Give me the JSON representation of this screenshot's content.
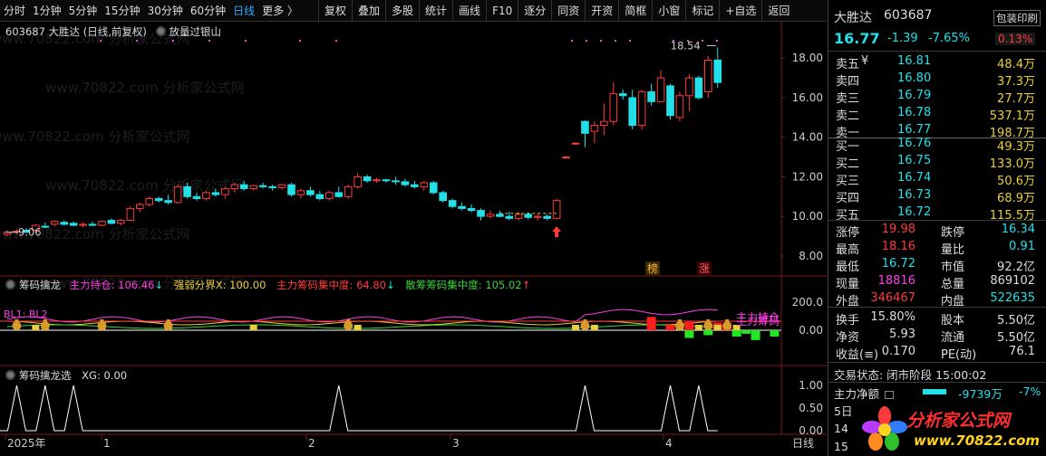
{
  "toolbar": {
    "timeframes": [
      "分时",
      "1分钟",
      "5分钟",
      "15分钟",
      "30分钟",
      "60分钟",
      "日线",
      "更多 〉"
    ],
    "active_timeframe": "日线",
    "buttons": [
      "复权",
      "叠加",
      "多股",
      "统计",
      "画线",
      "F10",
      "逐分",
      "同资",
      "开资",
      "简框",
      "小窗",
      "标记",
      "+自选",
      "返回"
    ]
  },
  "chart_header": {
    "code_name": "603687 大胜达 (日线,前复权)",
    "pattern_label": "放量过银山"
  },
  "price_axis": [
    "18.00",
    "16.00",
    "14.00",
    "12.00",
    "10.00",
    "8.00"
  ],
  "annotations": {
    "high": "18.54",
    "low": "9.06",
    "badge_bang": "榜",
    "badge_zhang": "涨"
  },
  "watermark": "www.70822.com 分析家公式网",
  "indicator1": {
    "name": "筹码擒龙",
    "item1_label": "主力持仓: 106.46",
    "item1_arrow": "↓",
    "item2_label": "强弱分界X: 100.00",
    "item3_label": "主力筹码集中度: 64.80",
    "item3_arrow": "↓",
    "item4_label": "散筹筹码集中度: 105.02",
    "item4_arrow": "↑",
    "axis": [
      "200.0",
      "0.00"
    ],
    "left_tags": "BL1: BL2",
    "right_tag": "主力持仓",
    "right_tag2": "主力筹码"
  },
  "indicator2": {
    "name": "筹码擒龙选",
    "xg_label": "XG: 0.00",
    "axis": [
      "1.00",
      "0.50",
      "0.00"
    ]
  },
  "date_axis": {
    "labels": [
      "2025年",
      "1",
      "2",
      "3",
      "4"
    ],
    "period": "日线"
  },
  "panel": {
    "name": "大胜达",
    "code": "603687",
    "tag": "包装印刷",
    "price": "16.77",
    "change": "-1.39",
    "change_pct": "-7.65%",
    "weibi": "0.13%",
    "asks": [
      {
        "label": "卖五",
        "mark": "¥",
        "price": "16.81",
        "vol": "48.4万"
      },
      {
        "label": "卖四",
        "mark": "",
        "price": "16.80",
        "vol": "37.3万"
      },
      {
        "label": "卖三",
        "mark": "",
        "price": "16.79",
        "vol": "27.7万"
      },
      {
        "label": "卖二",
        "mark": "",
        "price": "16.78",
        "vol": "537.1万"
      },
      {
        "label": "卖一",
        "mark": "",
        "price": "16.77",
        "vol": "198.7万"
      }
    ],
    "bids": [
      {
        "label": "买一",
        "price": "16.76",
        "vol": "49.3万"
      },
      {
        "label": "买二",
        "price": "16.75",
        "vol": "133.0万"
      },
      {
        "label": "买三",
        "price": "16.74",
        "vol": "50.6万"
      },
      {
        "label": "买四",
        "price": "16.73",
        "vol": "68.9万"
      },
      {
        "label": "买五",
        "price": "16.72",
        "vol": "115.5万"
      }
    ],
    "stats": [
      {
        "l1": "涨停",
        "v1": "19.98",
        "c1": "up",
        "l2": "跌停",
        "v2": "16.34",
        "c2": "dn"
      },
      {
        "l1": "最高",
        "v1": "18.16",
        "c1": "up",
        "l2": "量比",
        "v2": "0.91",
        "c2": "dn"
      },
      {
        "l1": "最低",
        "v1": "16.72",
        "c1": "dn",
        "l2": "市值",
        "v2": "92.2亿",
        "c2": "wht"
      },
      {
        "l1": "现量",
        "v1": "18816",
        "c1": "mag",
        "l2": "总量",
        "v2": "869102",
        "c2": "wht"
      },
      {
        "l1": "外盘",
        "v1": "346467",
        "c1": "up",
        "l2": "内盘",
        "v2": "522635",
        "c2": "dn"
      }
    ],
    "stats2": [
      {
        "l1": "换手",
        "v1": "15.80%",
        "c1": "wht",
        "l2": "股本",
        "v2": "5.50亿",
        "c2": "wht"
      },
      {
        "l1": "净资",
        "v1": "5.93",
        "c1": "wht",
        "l2": "流通",
        "v2": "5.50亿",
        "c2": "wht"
      },
      {
        "l1": "收益(≡)",
        "v1": "0.170",
        "c1": "wht",
        "l2": "PE(动)",
        "v2": "76.1",
        "c2": "wht"
      }
    ],
    "trade_status": "交易状态: 闭市阶段 15:00:02",
    "net_label": "主力净额",
    "net_value": "-9739万",
    "net_pct": "-7%",
    "day_row": "5日",
    "t_row1": "14",
    "t_row2": "15",
    "logo_text": "分析家公式网",
    "logo_url": "www.70822.com"
  },
  "chart_data": {
    "type": "candlestick",
    "ylim": [
      7.4,
      19.2
    ],
    "candles": [
      [
        9.1,
        9.3,
        9.0,
        9.2
      ],
      [
        9.2,
        9.35,
        9.1,
        9.25
      ],
      [
        9.3,
        9.4,
        9.15,
        9.2
      ],
      [
        9.3,
        9.6,
        9.25,
        9.55
      ],
      [
        9.5,
        9.7,
        9.4,
        9.45
      ],
      [
        9.6,
        9.8,
        9.5,
        9.75
      ],
      [
        9.7,
        9.8,
        9.55,
        9.6
      ],
      [
        9.65,
        9.75,
        9.5,
        9.55
      ],
      [
        9.55,
        9.7,
        9.45,
        9.6
      ],
      [
        9.6,
        9.75,
        9.5,
        9.55
      ],
      [
        9.55,
        9.8,
        9.5,
        9.75
      ],
      [
        9.8,
        9.9,
        9.6,
        9.65
      ],
      [
        9.65,
        9.85,
        9.55,
        9.8
      ],
      [
        9.8,
        10.5,
        9.75,
        10.4
      ],
      [
        10.4,
        10.7,
        10.2,
        10.6
      ],
      [
        10.6,
        11.0,
        10.5,
        10.9
      ],
      [
        10.9,
        11.0,
        10.7,
        10.8
      ],
      [
        10.8,
        11.1,
        10.6,
        10.7
      ],
      [
        10.7,
        11.6,
        10.65,
        11.5
      ],
      [
        11.5,
        11.7,
        10.9,
        11.0
      ],
      [
        11.0,
        11.2,
        10.8,
        10.9
      ],
      [
        10.9,
        11.3,
        10.8,
        11.2
      ],
      [
        11.2,
        11.4,
        11.0,
        11.1
      ],
      [
        11.1,
        11.5,
        10.9,
        11.4
      ],
      [
        11.4,
        11.7,
        11.2,
        11.6
      ],
      [
        11.6,
        11.8,
        11.3,
        11.4
      ],
      [
        11.4,
        11.6,
        11.3,
        11.55
      ],
      [
        11.55,
        11.7,
        11.4,
        11.5
      ],
      [
        11.5,
        11.6,
        11.3,
        11.45
      ],
      [
        11.45,
        11.65,
        11.35,
        11.6
      ],
      [
        11.6,
        11.7,
        11.0,
        11.1
      ],
      [
        11.1,
        11.4,
        10.9,
        11.3
      ],
      [
        11.3,
        11.5,
        11.0,
        11.1
      ],
      [
        11.1,
        11.3,
        10.8,
        10.9
      ],
      [
        10.9,
        11.3,
        10.8,
        11.2
      ],
      [
        11.2,
        11.5,
        10.95,
        11.0
      ],
      [
        11.0,
        11.6,
        10.9,
        11.5
      ],
      [
        11.5,
        12.2,
        11.4,
        12.0
      ],
      [
        12.0,
        12.1,
        11.7,
        11.8
      ],
      [
        11.8,
        11.95,
        11.7,
        11.85
      ],
      [
        11.85,
        11.9,
        11.7,
        11.8
      ],
      [
        11.8,
        12.0,
        11.6,
        11.75
      ],
      [
        11.75,
        11.9,
        11.5,
        11.6
      ],
      [
        11.6,
        11.8,
        11.4,
        11.5
      ],
      [
        11.5,
        11.8,
        11.3,
        11.7
      ],
      [
        11.7,
        11.8,
        11.1,
        11.2
      ],
      [
        11.2,
        11.3,
        10.7,
        10.8
      ],
      [
        10.8,
        10.9,
        10.4,
        10.5
      ],
      [
        10.5,
        10.7,
        10.3,
        10.4
      ],
      [
        10.4,
        10.6,
        10.2,
        10.3
      ],
      [
        10.3,
        10.4,
        9.8,
        10.0
      ],
      [
        10.0,
        10.3,
        9.9,
        10.1
      ],
      [
        10.1,
        10.3,
        9.95,
        10.0
      ],
      [
        10.0,
        10.25,
        9.8,
        9.9
      ],
      [
        9.9,
        10.2,
        9.8,
        10.1
      ],
      [
        10.1,
        10.2,
        9.85,
        9.95
      ],
      [
        9.95,
        10.15,
        9.8,
        10.0
      ],
      [
        10.0,
        10.1,
        9.8,
        9.9
      ],
      [
        9.9,
        10.9,
        9.85,
        10.8
      ],
      [
        13.0,
        13.05,
        12.95,
        13.0
      ],
      [
        13.7,
        13.75,
        13.65,
        13.7
      ],
      [
        14.8,
        14.85,
        13.5,
        14.2
      ],
      [
        14.3,
        14.8,
        13.7,
        14.6
      ],
      [
        14.6,
        15.7,
        14.1,
        14.8
      ],
      [
        14.8,
        16.8,
        14.6,
        16.2
      ],
      [
        16.2,
        16.4,
        15.9,
        16.1
      ],
      [
        16.0,
        16.4,
        14.4,
        14.6
      ],
      [
        14.6,
        16.4,
        14.4,
        16.3
      ],
      [
        16.3,
        16.7,
        15.6,
        15.8
      ],
      [
        15.8,
        17.4,
        15.8,
        17.0
      ],
      [
        16.6,
        16.7,
        14.9,
        15.1
      ],
      [
        15.0,
        16.3,
        14.8,
        16.1
      ],
      [
        16.1,
        17.2,
        15.3,
        17.0
      ],
      [
        17.0,
        17.1,
        15.9,
        16.0
      ],
      [
        16.3,
        18.1,
        16.0,
        17.9
      ],
      [
        17.9,
        18.54,
        16.5,
        16.77
      ]
    ],
    "ind1": {
      "red_bars": [
        [
          68,
          95
        ],
        [
          75,
          55
        ],
        [
          72,
          60
        ],
        [
          76,
          35
        ],
        [
          70,
          40
        ]
      ],
      "green_bars": [
        [
          72,
          -55
        ],
        [
          74,
          -35
        ],
        [
          77,
          -45
        ],
        [
          78,
          -25
        ],
        [
          81,
          -45
        ],
        [
          79,
          -70
        ]
      ]
    },
    "ind2_peaks": [
      1,
      4,
      7,
      35,
      61,
      70,
      73
    ]
  }
}
